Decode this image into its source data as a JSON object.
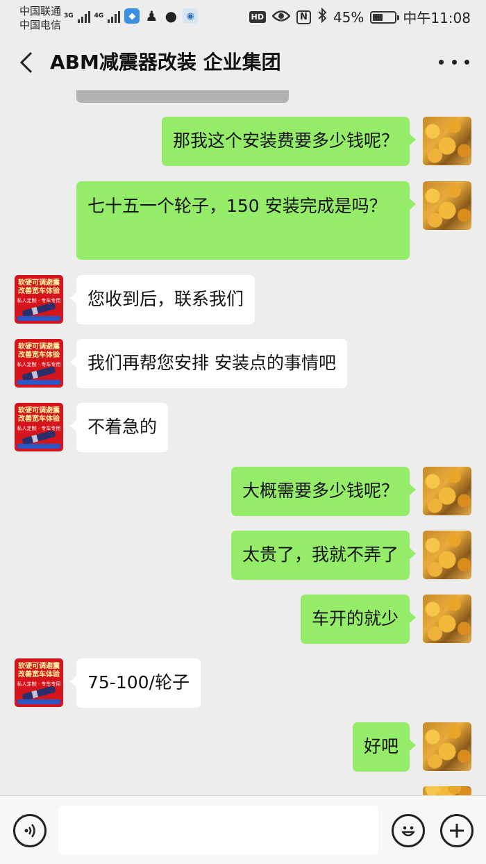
{
  "status_bar": {
    "carrier_1": "中国联通",
    "carrier_2": "中国电信",
    "net_1": "3G",
    "net_2": "4G",
    "hd": "HD",
    "nfc": "N",
    "bluetooth": "✱",
    "battery_percent": "45%",
    "battery_level": 0.45,
    "time": "中午11:08"
  },
  "header": {
    "title": "ABM减震器改装 企业集团"
  },
  "avatars": {
    "shop": {
      "line1": "软硬可调避震",
      "line2": "改善宽车体验",
      "line3": "私人定制 · 专车专用"
    }
  },
  "messages": [
    {
      "side": "right",
      "text": "那我这个安装费要多少钱呢？"
    },
    {
      "side": "right",
      "text": "七十五一个轮子，150 安装完成是吗？"
    },
    {
      "side": "left",
      "text": "您收到后，联系我们"
    },
    {
      "side": "left",
      "text": "我们再帮您安排 安装点的事情吧"
    },
    {
      "side": "left",
      "text": "不着急的"
    },
    {
      "side": "right",
      "text": "大概需要多少钱呢？"
    },
    {
      "side": "right",
      "text": "太贵了，我就不弄了"
    },
    {
      "side": "right",
      "text": "车开的就少"
    },
    {
      "side": "left",
      "text": "75-100/轮子"
    },
    {
      "side": "right",
      "text": "好吧"
    }
  ],
  "input_bar": {
    "placeholder": "",
    "voice_icon": "voice-icon",
    "emoji_icon": "emoji-icon",
    "plus_icon": "plus-icon"
  },
  "colors": {
    "background": "#ededed",
    "bubble_self": "#95ec69",
    "bubble_other": "#ffffff"
  }
}
